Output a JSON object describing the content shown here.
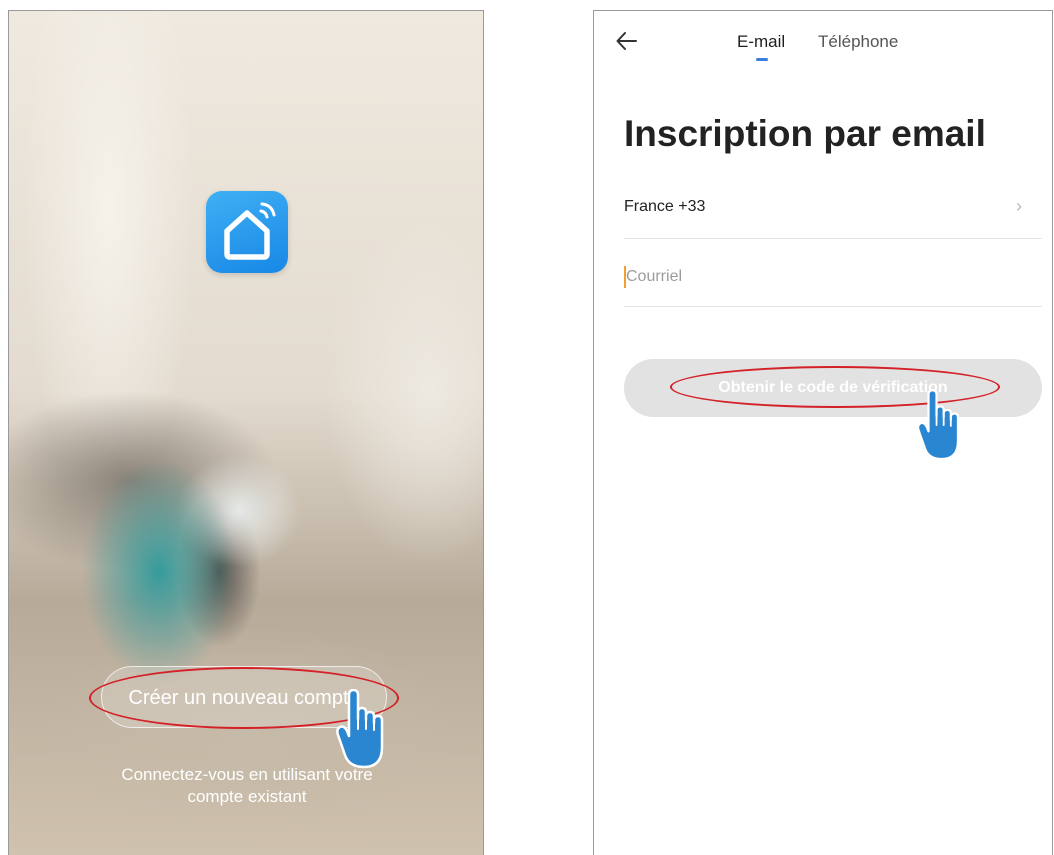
{
  "left_screen": {
    "create_account_label": "Créer un nouveau compte",
    "login_line1": "Connectez-vous en utilisant votre",
    "login_line2": "compte existant"
  },
  "right_screen": {
    "tabs": [
      {
        "label": "E-mail",
        "active": true
      },
      {
        "label": "Téléphone",
        "active": false
      }
    ],
    "title": "Inscription par email",
    "country_value": "France +33",
    "email_placeholder": "Courriel",
    "email_value": "",
    "verify_button_label": "Obtenir le code de vérification",
    "verify_button_enabled": false
  },
  "colors": {
    "annotation_red": "#d42027",
    "hand_blue": "#2a86d0",
    "app_logo_blue": "#1f93ee",
    "tab_indicator": "#3a7ee0",
    "disabled_button": "#e2e2e2"
  },
  "icons": {
    "app_logo": "smart-home-wifi-icon",
    "back": "arrow-left-icon",
    "chevron": "chevron-right-icon",
    "pointer": "hand-pointer-icon"
  }
}
